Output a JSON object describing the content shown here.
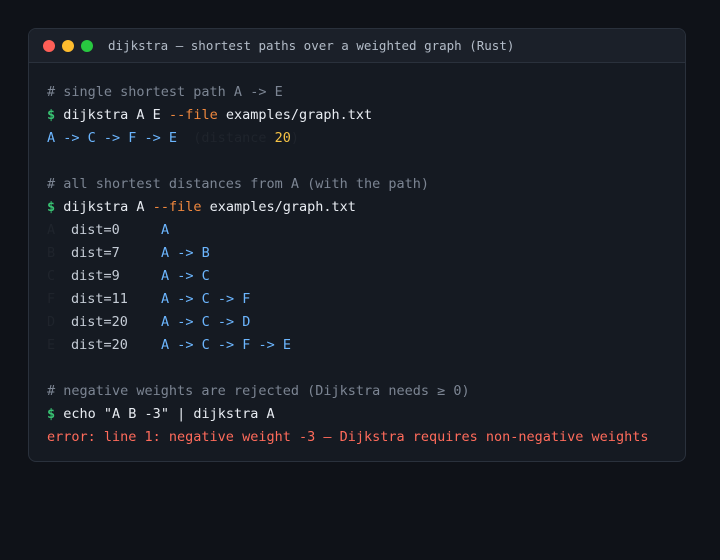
{
  "window": {
    "title": "dijkstra — shortest paths over a weighted graph (Rust)"
  },
  "session": {
    "block1": {
      "comment": "# single shortest path A -> E",
      "prompt": "$",
      "cmd_pre": "dijkstra A E ",
      "flag": "--file",
      "cmd_post": " examples/graph.txt",
      "path": "A -> C -> F -> E",
      "dist_open": "  (distance ",
      "dist_value": "20",
      "dist_close": ")"
    },
    "block2": {
      "comment": "# all shortest distances from A (with the path)",
      "prompt": "$",
      "cmd_pre": "dijkstra A ",
      "flag": "--file",
      "cmd_post": " examples/graph.txt",
      "rows": [
        {
          "node": "A",
          "dist": "dist=0",
          "path": "A"
        },
        {
          "node": "B",
          "dist": "dist=7",
          "path": "A -> B"
        },
        {
          "node": "C",
          "dist": "dist=9",
          "path": "A -> C"
        },
        {
          "node": "F",
          "dist": "dist=11",
          "path": "A -> C -> F"
        },
        {
          "node": "D",
          "dist": "dist=20",
          "path": "A -> C -> D"
        },
        {
          "node": "E",
          "dist": "dist=20",
          "path": "A -> C -> F -> E"
        }
      ]
    },
    "block3": {
      "comment": "# negative weights are rejected (Dijkstra needs ≥ 0)",
      "prompt": "$",
      "cmd": "echo \"A B -3\" | dijkstra A",
      "error": "error: line 1: negative weight -3 — Dijkstra requires non-negative weights"
    }
  },
  "colors": {
    "background": "#0f1218",
    "window": "#151a22",
    "prompt": "#38c172",
    "flag": "#f0883e",
    "path": "#6cb6ff",
    "number": "#f6c345",
    "error": "#ff6b5b",
    "comment": "#7c8593"
  }
}
